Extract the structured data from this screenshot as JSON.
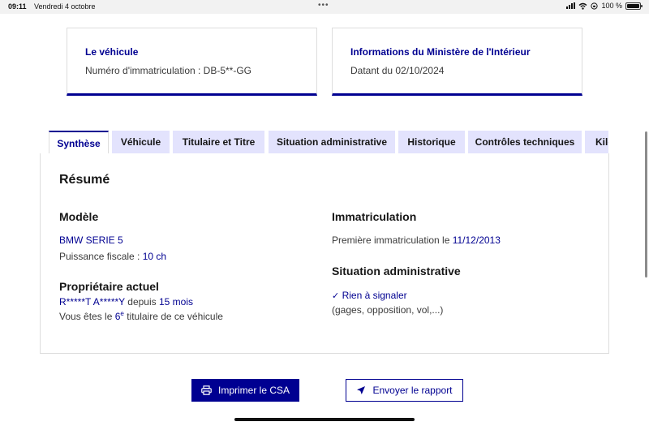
{
  "status_bar": {
    "time": "09:11",
    "date": "Vendredi 4 octobre",
    "dots": "•••",
    "battery": "100 %"
  },
  "cards": {
    "vehicle": {
      "title": "Le véhicule",
      "text": "Numéro d'immatriculation : DB-5**-GG"
    },
    "ministry": {
      "title": "Informations du Ministère de l'Intérieur",
      "text": "Datant du 02/10/2024"
    }
  },
  "tabs": [
    "Synthèse",
    "Véhicule",
    "Titulaire et Titre",
    "Situation administrative",
    "Historique",
    "Contrôles techniques",
    "Kilo"
  ],
  "summary": {
    "heading": "Résumé",
    "model": {
      "heading": "Modèle",
      "name": "BMW SERIE 5",
      "power_label": "Puissance fiscale : ",
      "power_value": "10 ch"
    },
    "owner": {
      "heading": "Propriétaire actuel",
      "name": "R*****T A*****Y",
      "since_label": " depuis ",
      "since_value": "15 mois",
      "rank_prefix": "Vous êtes le ",
      "rank_number": "6",
      "rank_sup": "e",
      "rank_suffix": " titulaire de ce véhicule"
    },
    "registration": {
      "heading": "Immatriculation",
      "label": "Première immatriculation le ",
      "date": "11/12/2013"
    },
    "admin": {
      "heading": "Situation administrative",
      "status": "Rien à signaler",
      "detail": "(gages, opposition, vol,...)"
    }
  },
  "buttons": {
    "print": "Imprimer le CSA",
    "send": "Envoyer le rapport"
  },
  "colors": {
    "primary": "#000091",
    "tab_bg": "#e3e3fd",
    "border": "#dddddd"
  }
}
